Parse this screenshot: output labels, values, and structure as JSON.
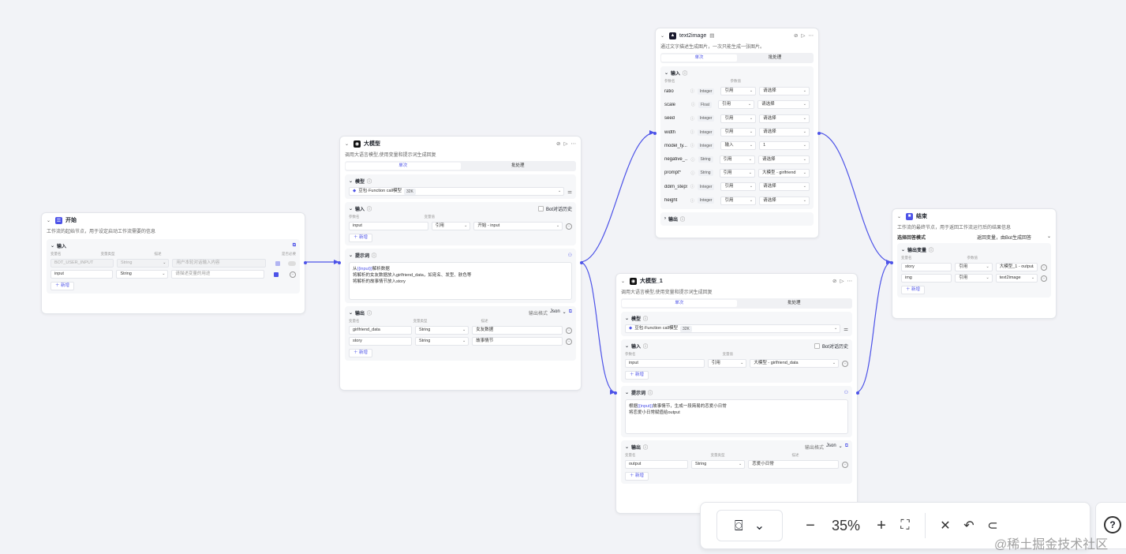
{
  "start": {
    "title": "开始",
    "desc": "工作流的起始节点，用于设定启动工作流需要的信息",
    "input_title": "输入",
    "cols": [
      "变量名",
      "变量类型",
      "描述",
      "是否必要"
    ],
    "rows": [
      {
        "name": "BOT_USER_INPUT",
        "type": "String",
        "desc": "用户本轮对话输入内容"
      },
      {
        "name": "input",
        "type": "String",
        "desc": "请描述变量的用途"
      }
    ],
    "add": "新增"
  },
  "llm": {
    "title": "大模型",
    "desc": "调用大语言模型,使用变量和提示词生成回复",
    "tab_single": "单次",
    "tab_batch": "批处理",
    "model_title": "模型",
    "model_name": "豆包·Function call模型",
    "model_ctx": "32K",
    "input_title": "输入",
    "bot_history": "Bot对话历史",
    "input_cols": [
      "参数名",
      "变量值"
    ],
    "input_row": {
      "name": "input",
      "mode": "引用",
      "value": "开始 - input"
    },
    "add": "新增",
    "prompt_title": "提示词",
    "prompt_lines": [
      "从{{input}}解析数据",
      "将解析的女友数据放入girlfriend_data，如宠名、发型、肤色等",
      "将解析的故事情节放入story"
    ],
    "output_title": "输出",
    "output_format_label": "输出格式",
    "output_format": "Json",
    "output_cols": [
      "变量名",
      "变量类型",
      "描述"
    ],
    "outputs": [
      {
        "name": "girlfriend_data",
        "type": "String",
        "desc": "女友数据"
      },
      {
        "name": "story",
        "type": "String",
        "desc": "故事情节"
      }
    ]
  },
  "text2image": {
    "title": "text2image",
    "desc": "通过文字描述生成图片，一次只能生成一张图片。",
    "tab_single": "单次",
    "tab_batch": "批处理",
    "input_title": "输入",
    "cols": [
      "参数名",
      "参数值"
    ],
    "params": [
      {
        "name": "ratio",
        "type": "Integer",
        "mode": "引用",
        "value": "请选择"
      },
      {
        "name": "scale",
        "type": "Float",
        "mode": "引用",
        "value": "请选择"
      },
      {
        "name": "seed",
        "type": "Integer",
        "mode": "引用",
        "value": "请选择"
      },
      {
        "name": "width",
        "type": "Integer",
        "mode": "引用",
        "value": "请选择"
      },
      {
        "name": "model_ty...",
        "type": "Integer",
        "mode": "输入",
        "value": "1"
      },
      {
        "name": "negative_...",
        "type": "String",
        "mode": "引用",
        "value": "请选择"
      },
      {
        "name": "prompt*",
        "type": "String",
        "mode": "引用",
        "value": "大模型 - girlfriend"
      },
      {
        "name": "ddim_steps",
        "type": "Integer",
        "mode": "引用",
        "value": "请选择"
      },
      {
        "name": "height",
        "type": "Integer",
        "mode": "引用",
        "value": "请选择"
      }
    ],
    "output_title": "输出"
  },
  "llm1": {
    "title": "大模型_1",
    "desc": "调用大语言模型,使用变量和提示词生成回复",
    "tab_single": "单次",
    "tab_batch": "批处理",
    "model_title": "模型",
    "model_name": "豆包·Function call模型",
    "model_ctx": "32K",
    "input_title": "输入",
    "bot_history": "Bot对话历史",
    "input_cols": [
      "参数名",
      "变量值"
    ],
    "input_row": {
      "name": "input",
      "mode": "引用",
      "value": "大模型 - girlfriend_data"
    },
    "add": "新增",
    "prompt_title": "提示词",
    "prompt_lines": [
      "根据{{input}}故事情节，生成一段简易的恋爱小日常",
      "将恋爱小日常赋值给output"
    ],
    "output_title": "输出",
    "output_format_label": "输出格式",
    "output_format": "Json",
    "output_cols": [
      "变量名",
      "变量类型",
      "描述"
    ],
    "outputs": [
      {
        "name": "output",
        "type": "String",
        "desc": "恋爱小日常"
      }
    ]
  },
  "end": {
    "title": "结束",
    "desc": "工作流的最终节点，用于返回工作流运行后的结果信息",
    "mode_label": "选择回答模式",
    "mode_value": "返回变量，由Bot生成回答",
    "output_title": "输出变量",
    "cols": [
      "变量名",
      "参数值"
    ],
    "rows": [
      {
        "name": "story",
        "mode": "引用",
        "value": "大模型_1 - output"
      },
      {
        "name": "img",
        "mode": "引用",
        "value": "text2image"
      }
    ],
    "add": "新增"
  },
  "toolbar": {
    "zoom": "35%"
  },
  "watermark": "@稀土掘金技术社区",
  "colors": {
    "accent": "#4d53e8",
    "canvas": "#f2f3f7"
  }
}
